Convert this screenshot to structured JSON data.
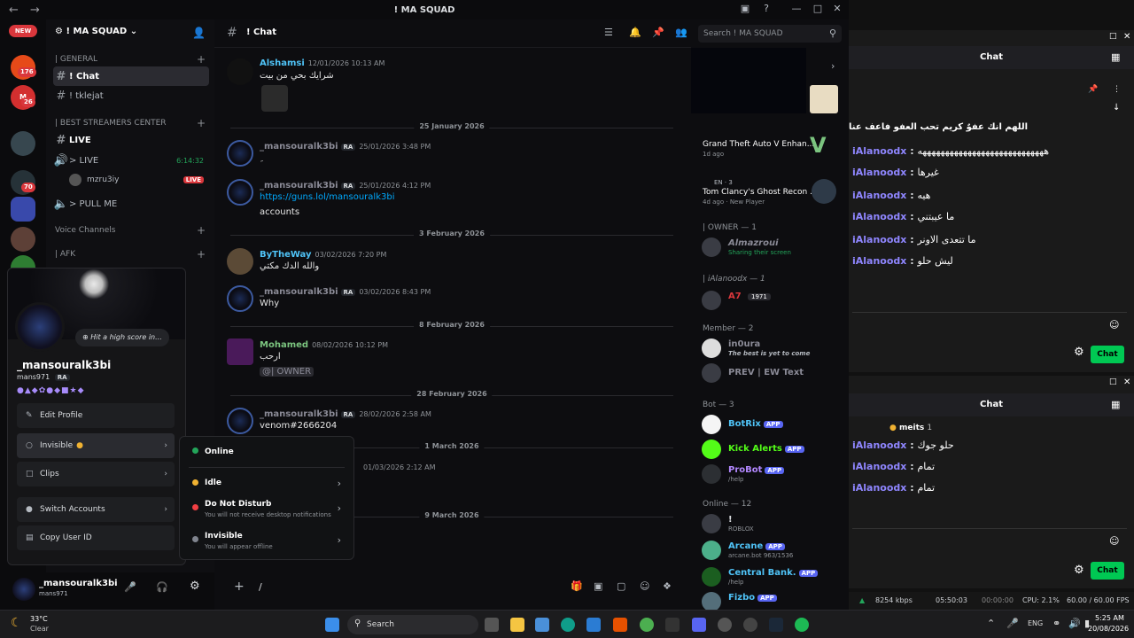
{
  "window": {
    "title": "! MA SQUAD"
  },
  "rail": {
    "new_badge": "NEW",
    "badges": [
      "176",
      "26",
      "70"
    ]
  },
  "server": {
    "name": "! MA SQUAD"
  },
  "sidebar": {
    "general_header": "| GENERAL",
    "channels_general": [
      {
        "label": "! Chat"
      },
      {
        "label": "! tklejat"
      }
    ],
    "streamers_header": "| BEST STREAMERS CENTER",
    "live_channel": "LIVE",
    "voice_live": "> LIVE",
    "voice_live_time": "6:14:32",
    "live_user": "mzru3iy",
    "live_badge": "LIVE",
    "pull_me": "> PULL ME",
    "voice_header": "Voice Channels",
    "afk": "| AFK"
  },
  "chat": {
    "channel": "! Chat",
    "search_placeholder": "Search ! MA SQUAD",
    "messages": [
      {
        "user": "Alshamsi",
        "time": "12/01/2026 10:13 AM",
        "text": "شرايك بحي من بيت",
        "color": "#4fc3f7"
      },
      {
        "user": "_mansouralk3bi",
        "tag": "RA",
        "time": "25/01/2026 3:48 PM",
        "text": "ِ",
        "color": "#8a8a96"
      },
      {
        "user": "_mansouralk3bi",
        "tag": "RA",
        "time": "25/01/2026 4:12 PM",
        "link": "https://guns.lol/mansouralk3bi",
        "text": "accounts",
        "color": "#8a8a96"
      },
      {
        "user": "ByTheWay",
        "time": "03/02/2026 7:20 PM",
        "text": "والله الدك مكتي",
        "color": "#4fc3f7"
      },
      {
        "user": "_mansouralk3bi",
        "tag": "RA",
        "time": "03/02/2026 8:43 PM",
        "text": "Why",
        "color": "#8a8a96"
      },
      {
        "user": "Mohamed",
        "time": "08/02/2026 10:12 PM",
        "text": "ارحب",
        "mention": "@| OWNER",
        "color": "#7bc47f"
      },
      {
        "user": "_mansouralk3bi",
        "tag": "RA",
        "time": "28/02/2026 2:58 AM",
        "text": "venom#2666204",
        "color": "#8a8a96"
      },
      {
        "time": "01/03/2026 2:12 AM"
      }
    ],
    "dividers": [
      "25 January 2026",
      "3 February 2026",
      "8 February 2026",
      "28 February 2026",
      "1 March 2026",
      "9 March 2026"
    ],
    "composer_placeholder": "/"
  },
  "members": {
    "activity": [
      {
        "title": "Grand Theft Auto V Enhan...",
        "sub": "1d ago"
      },
      {
        "title": "Tom Clancy's Ghost Recon ...",
        "sub": "4d ago · New Player",
        "lang": "EN · 3"
      }
    ],
    "owner_header": "| OWNER — 1",
    "owner": {
      "name": "Almazroui",
      "sub": "Sharing their screen"
    },
    "ialan_header": "| iAlanoodx — 1",
    "ialan": {
      "name": "A7",
      "tag": "1971"
    },
    "member_header": "Member — 2",
    "member_list": [
      {
        "name": "in0ura",
        "sub": "The best is yet to come"
      },
      {
        "name": "PREV | EW Text",
        "sub": ""
      }
    ],
    "bot_header": "Bot — 3",
    "bots": [
      {
        "name": "BotRix",
        "app": "APP"
      },
      {
        "name": "Kick Alerts",
        "app": "APP"
      },
      {
        "name": "ProBot",
        "app": "APP",
        "sub": "/help"
      }
    ],
    "online_header": "Online — 12",
    "online": [
      {
        "name": "!",
        "sub": "ROBLOX"
      },
      {
        "name": "Arcane",
        "app": "APP",
        "sub": "arcane.bot 963/1536"
      },
      {
        "name": "Central Bank.",
        "app": "APP",
        "sub": "/help"
      },
      {
        "name": "Fizbo",
        "app": "APP"
      }
    ]
  },
  "profile": {
    "custom_status": "Hit a high score in...",
    "display_name": "_mansouralk3bi",
    "username": "mans971",
    "tag": "RA",
    "items": {
      "edit": "Edit Profile",
      "status": "Invisible",
      "clips": "Clips",
      "switch": "Switch Accounts",
      "copy": "Copy User ID"
    }
  },
  "status_menu": {
    "options": [
      {
        "label": "Online",
        "color": "#23a55a"
      },
      {
        "label": "Idle",
        "color": "#f0b232"
      },
      {
        "label": "Do Not Disturb",
        "desc": "You will not receive desktop notifications",
        "color": "#f23f43"
      },
      {
        "label": "Invisible",
        "desc": "You will appear offline",
        "color": "#80848e"
      }
    ]
  },
  "userbar": {
    "name": "_mansouralk3bi",
    "user": "mans971"
  },
  "twitch": {
    "header": "Chat",
    "chat_btn": "Chat",
    "top_msg": "اللهم انك عفوٌ كريم تحب العفو فاعف عنا",
    "lines1": [
      {
        "n": "iAlanoodx",
        "t": "ههههههههههههههههههههههههههههه"
      },
      {
        "n": "iAlanoodx",
        "t": "غيرها"
      },
      {
        "n": "iAlanoodx",
        "t": "هيه"
      },
      {
        "n": "iAlanoodx",
        "t": "ما عيبتني"
      },
      {
        "n": "iAlanoodx",
        "t": "ما تتعدى الاونر"
      },
      {
        "n": "iAlanoodx",
        "t": "ليش حلو"
      }
    ],
    "meits_label": "meits",
    "meits_count": "1",
    "lines2": [
      {
        "n": "iAlanoodx",
        "t": "حلو جوك"
      },
      {
        "n": "iAlanoodx",
        "t": "تمام"
      },
      {
        "n": "iAlanoodx",
        "t": "تمام"
      }
    ]
  },
  "obs": {
    "bitrate": "8254 kbps",
    "time": "05:50:03",
    "rec": "00:00:00",
    "cpu": "CPU: 2.1%",
    "fps": "60.00 / 60.00 FPS"
  },
  "taskbar": {
    "temp": "33°C",
    "weather": "Clear",
    "search": "Search",
    "lang": "ENG",
    "time": "5:25 AM",
    "date": "20/08/2026"
  }
}
